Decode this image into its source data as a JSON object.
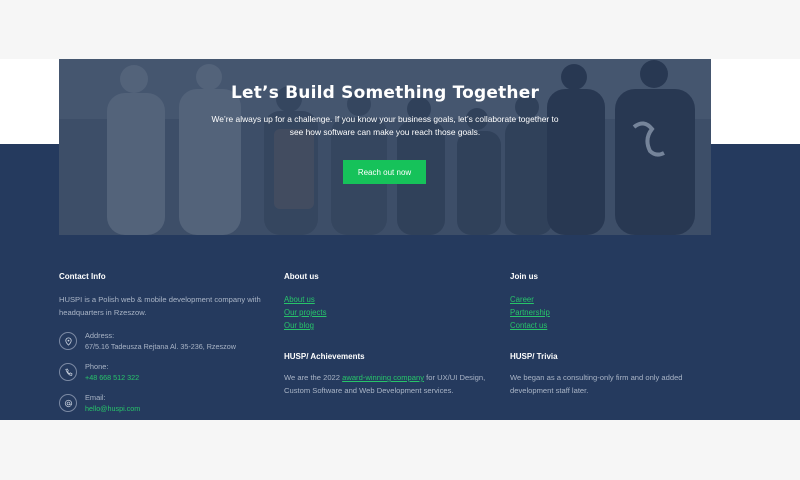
{
  "hero": {
    "title": "Let’s Build Something Together",
    "text": "We’re always up for a challenge. If you know your business goals, let’s collaborate together to see how software can make you reach those goals.",
    "button_label": "Reach out now"
  },
  "contact": {
    "heading": "Contact Info",
    "description": "HUSPI is a Polish web & mobile development company with headquarters in Rzeszow.",
    "items": [
      {
        "icon": "location-pin-icon",
        "label": "Address:",
        "value": "67/5.16 Tadeusza Rejtana Al. 35-236, Rzeszow"
      },
      {
        "icon": "phone-icon",
        "label": "Phone:",
        "value": "+48 668 512 322"
      },
      {
        "icon": "at-sign-icon",
        "label": "Email:",
        "value": "hello@huspi.com"
      }
    ]
  },
  "about": {
    "heading": "About us",
    "links": [
      "About us",
      "Our projects",
      "Our blog"
    ]
  },
  "join": {
    "heading": "Join us",
    "links": [
      "Career",
      "Partnership",
      "Contact us"
    ]
  },
  "achievements": {
    "heading": "HUSP/ Achievements",
    "text_before": "We are the 2022 ",
    "link": "award-winning company",
    "text_after": " for UX/UI Design, Custom Software and Web Development services."
  },
  "trivia": {
    "heading": "HUSP/ Trivia",
    "text": "We began as a consulting-only firm and only added development staff later."
  },
  "colors": {
    "footer_bg": "#253a5e",
    "accent_green": "#16c25a",
    "muted_text": "#a9b4c6"
  }
}
